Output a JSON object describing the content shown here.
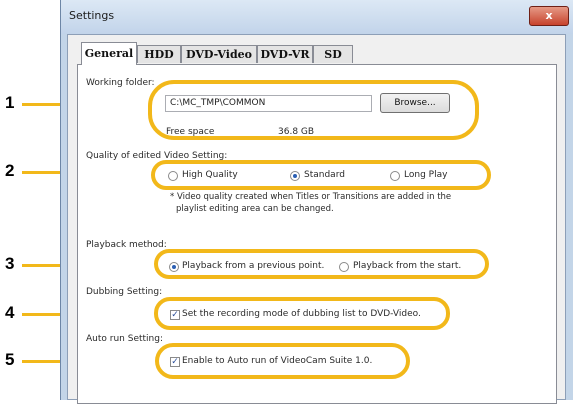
{
  "window": {
    "title": "Settings",
    "close_glyph": "x"
  },
  "tabs": [
    "General",
    "HDD",
    "DVD-Video",
    "DVD-VR",
    "SD"
  ],
  "working_folder": {
    "label": "Working folder:",
    "path": "C:\\MC_TMP\\COMMON",
    "browse_label": "Browse...",
    "free_space_label": "Free space",
    "free_space_value": "36.8 GB"
  },
  "quality": {
    "label": "Quality of edited Video Setting:",
    "options": [
      "High Quality",
      "Standard",
      "Long Play"
    ],
    "selected": "Standard",
    "note_line1": "* Video quality created when Titles or Transitions are added in the",
    "note_line2": "playlist editing area can be changed."
  },
  "playback": {
    "label": "Playback method:",
    "options": [
      "Playback from a previous point.",
      "Playback from the start."
    ],
    "selected": "Playback from a previous point."
  },
  "dubbing": {
    "label": "Dubbing Setting:",
    "checkbox_label": "Set the recording mode of dubbing list to DVD-Video.",
    "checked": true
  },
  "autorun": {
    "label": "Auto run Setting:",
    "checkbox_label": "Enable to Auto run of VideoCam Suite 1.0.",
    "checked": true
  },
  "callouts": [
    "1",
    "2",
    "3",
    "4",
    "5"
  ],
  "colors": {
    "highlight": "#f2b81a",
    "window_frame": "#c3d5e8",
    "radio_dot": "#2b5fb3"
  }
}
